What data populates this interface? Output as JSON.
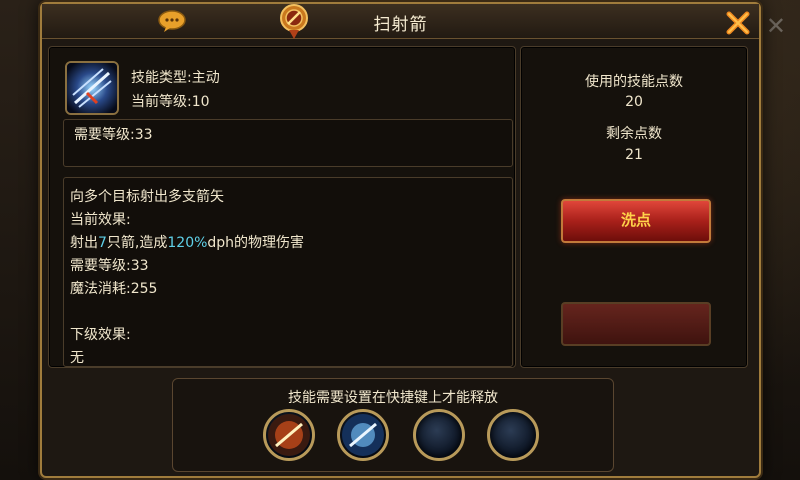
{
  "dialog": {
    "title": "扫射箭",
    "icons": [
      "chat-icon",
      "medal-icon",
      "close-icon"
    ]
  },
  "skill": {
    "type_line": "技能类型:主动",
    "level_line": "当前等级:10",
    "required_level": "需要等级:33",
    "icon": "arrow-volley-skill-icon"
  },
  "description": {
    "line1": "向多个目标射出多支箭矢",
    "current_label": "当前效果:",
    "effect_prefix": "射出",
    "effect_arrows": "7",
    "effect_mid": "只箭,造成",
    "effect_pct": "120%",
    "effect_suffix": "dph的物理伤害",
    "req_level": "需要等级:33",
    "mana_cost": "魔法消耗:255",
    "next_label": "下级效果:",
    "next_partial": "无"
  },
  "points": {
    "used_label": "使用的技能点数",
    "used_value": "20",
    "remaining_label": "剩余点数",
    "remaining_value": "21",
    "reset_button": "洗点"
  },
  "hotkey": {
    "hint": "技能需要设置在快捷键上才能释放",
    "slots": [
      "slot-1-fire-skill",
      "slot-2-arrow-skill",
      "slot-3-empty",
      "slot-4-empty"
    ]
  },
  "colors": {
    "highlight": "#5fd0e8",
    "button_text": "#ffd24a",
    "frame": "#a07c3c"
  }
}
